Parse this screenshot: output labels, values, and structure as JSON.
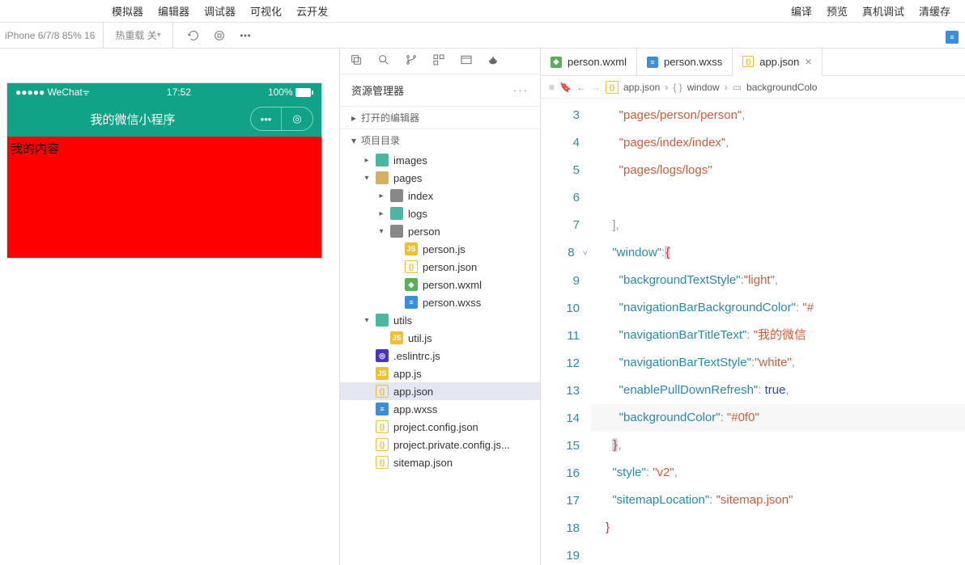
{
  "topMenu": {
    "left": [
      "模拟器",
      "编辑器",
      "调试器",
      "可视化",
      "云开发"
    ],
    "right": [
      "编译",
      "预览",
      "真机调试",
      "清缓存"
    ]
  },
  "toolbar": {
    "device": "iPhone 6/7/8 85% 16",
    "hotReload": "热重载 关"
  },
  "simulator": {
    "statusLeft": "●●●●● WeChat",
    "time": "17:52",
    "battery": "100%",
    "navTitle": "我的微信小程序",
    "bodyText": "我的内容"
  },
  "explorer": {
    "title": "资源管理器",
    "more": "···",
    "sectionOpen": "打开的编辑器",
    "sectionProj": "项目目录",
    "tree": [
      {
        "indent": 1,
        "chev": "▸",
        "icon": "ic-folder-img",
        "label": "images"
      },
      {
        "indent": 1,
        "chev": "▾",
        "icon": "ic-folder",
        "label": "pages"
      },
      {
        "indent": 2,
        "chev": "▸",
        "icon": "ic-folder-gray",
        "label": "index"
      },
      {
        "indent": 2,
        "chev": "▸",
        "icon": "ic-folder-teal",
        "label": "logs"
      },
      {
        "indent": 2,
        "chev": "▾",
        "icon": "ic-folder-gray",
        "label": "person"
      },
      {
        "indent": 3,
        "chev": " ",
        "icon": "ic-js",
        "iconText": "JS",
        "label": "person.js"
      },
      {
        "indent": 3,
        "chev": " ",
        "icon": "ic-json",
        "iconText": "{}",
        "label": "person.json"
      },
      {
        "indent": 3,
        "chev": " ",
        "icon": "ic-wxml",
        "iconText": "◆",
        "label": "person.wxml"
      },
      {
        "indent": 3,
        "chev": " ",
        "icon": "ic-wxss",
        "iconText": "≡",
        "label": "person.wxss"
      },
      {
        "indent": 1,
        "chev": "▾",
        "icon": "ic-folder-teal",
        "label": "utils"
      },
      {
        "indent": 2,
        "chev": " ",
        "icon": "ic-js",
        "iconText": "JS",
        "label": "util.js"
      },
      {
        "indent": 1,
        "chev": " ",
        "icon": "ic-eslint",
        "iconText": "◎",
        "label": ".eslintrc.js"
      },
      {
        "indent": 1,
        "chev": " ",
        "icon": "ic-js",
        "iconText": "JS",
        "label": "app.js"
      },
      {
        "indent": 1,
        "chev": " ",
        "icon": "ic-json",
        "iconText": "{}",
        "label": "app.json",
        "selected": true
      },
      {
        "indent": 1,
        "chev": " ",
        "icon": "ic-wxss",
        "iconText": "≡",
        "label": "app.wxss"
      },
      {
        "indent": 1,
        "chev": " ",
        "icon": "ic-json",
        "iconText": "{}",
        "label": "project.config.json"
      },
      {
        "indent": 1,
        "chev": " ",
        "icon": "ic-json",
        "iconText": "{}",
        "label": "project.private.config.js..."
      },
      {
        "indent": 1,
        "chev": " ",
        "icon": "ic-json",
        "iconText": "{}",
        "label": "sitemap.json"
      }
    ]
  },
  "tabs": [
    {
      "icon": "ic-wxml",
      "iconText": "◆",
      "label": "person.wxml",
      "active": false
    },
    {
      "icon": "ic-wxss",
      "iconText": "≡",
      "label": "person.wxss",
      "active": false
    },
    {
      "icon": "ic-json",
      "iconText": "{}",
      "label": "app.json",
      "active": true,
      "closable": true
    }
  ],
  "breadcrumb": {
    "file": "app.json",
    "seg1": "window",
    "seg2": "backgroundColo"
  },
  "code": {
    "startLine": 3,
    "lines": [
      {
        "n": 3,
        "html": "    <span class='str'>\"pages/person/person\"</span><span class='punct'>,</span>"
      },
      {
        "n": 4,
        "html": "    <span class='str'>\"pages/index/index\"</span><span class='punct'>,</span>"
      },
      {
        "n": 5,
        "html": "    <span class='str'>\"pages/logs/logs\"</span>"
      },
      {
        "n": 6,
        "html": ""
      },
      {
        "n": 7,
        "html": "  <span class='punct'>]</span><span class='punct'>,</span>"
      },
      {
        "n": 8,
        "html": "  <span class='key'>\"window\"</span><span class='punct'>:</span><span class='val-brace hl-brace'>{</span>",
        "fold": "˅"
      },
      {
        "n": 9,
        "html": "    <span class='key'>\"backgroundTextStyle\"</span><span class='punct'>:</span><span class='str'>\"light\"</span><span class='punct'>,</span>"
      },
      {
        "n": 10,
        "html": "    <span class='key'>\"navigationBarBackgroundColor\"</span><span class='punct'>:</span> <span class='str'>\"#</span>"
      },
      {
        "n": 11,
        "html": "    <span class='key'>\"navigationBarTitleText\"</span><span class='punct'>:</span> <span class='str'>\"我的微信</span>"
      },
      {
        "n": 12,
        "html": "    <span class='key'>\"navigationBarTextStyle\"</span><span class='punct'>:</span><span class='str'>\"white\"</span><span class='punct'>,</span>"
      },
      {
        "n": 13,
        "html": "    <span class='key'>\"enablePullDownRefresh\"</span><span class='punct'>:</span> <span class='val-bool'>true</span><span class='punct'>,</span>"
      },
      {
        "n": 14,
        "html": "    <span class='key'>\"backgroundColor\"</span><span class='punct'>:</span> <span class='str'>\"#0f0\"</span>",
        "hl": true
      },
      {
        "n": 15,
        "html": "  <span class='val-brace hl-brace'>}</span><span class='punct'>,</span>"
      },
      {
        "n": 16,
        "html": "  <span class='key'>\"style\"</span><span class='punct'>:</span> <span class='str'>\"v2\"</span><span class='punct'>,</span>"
      },
      {
        "n": 17,
        "html": "  <span class='key'>\"sitemapLocation\"</span><span class='punct'>:</span> <span class='str'>\"sitemap.json\"</span>"
      },
      {
        "n": 18,
        "html": "<span class='val-brace'>}</span>"
      },
      {
        "n": 19,
        "html": ""
      }
    ]
  }
}
